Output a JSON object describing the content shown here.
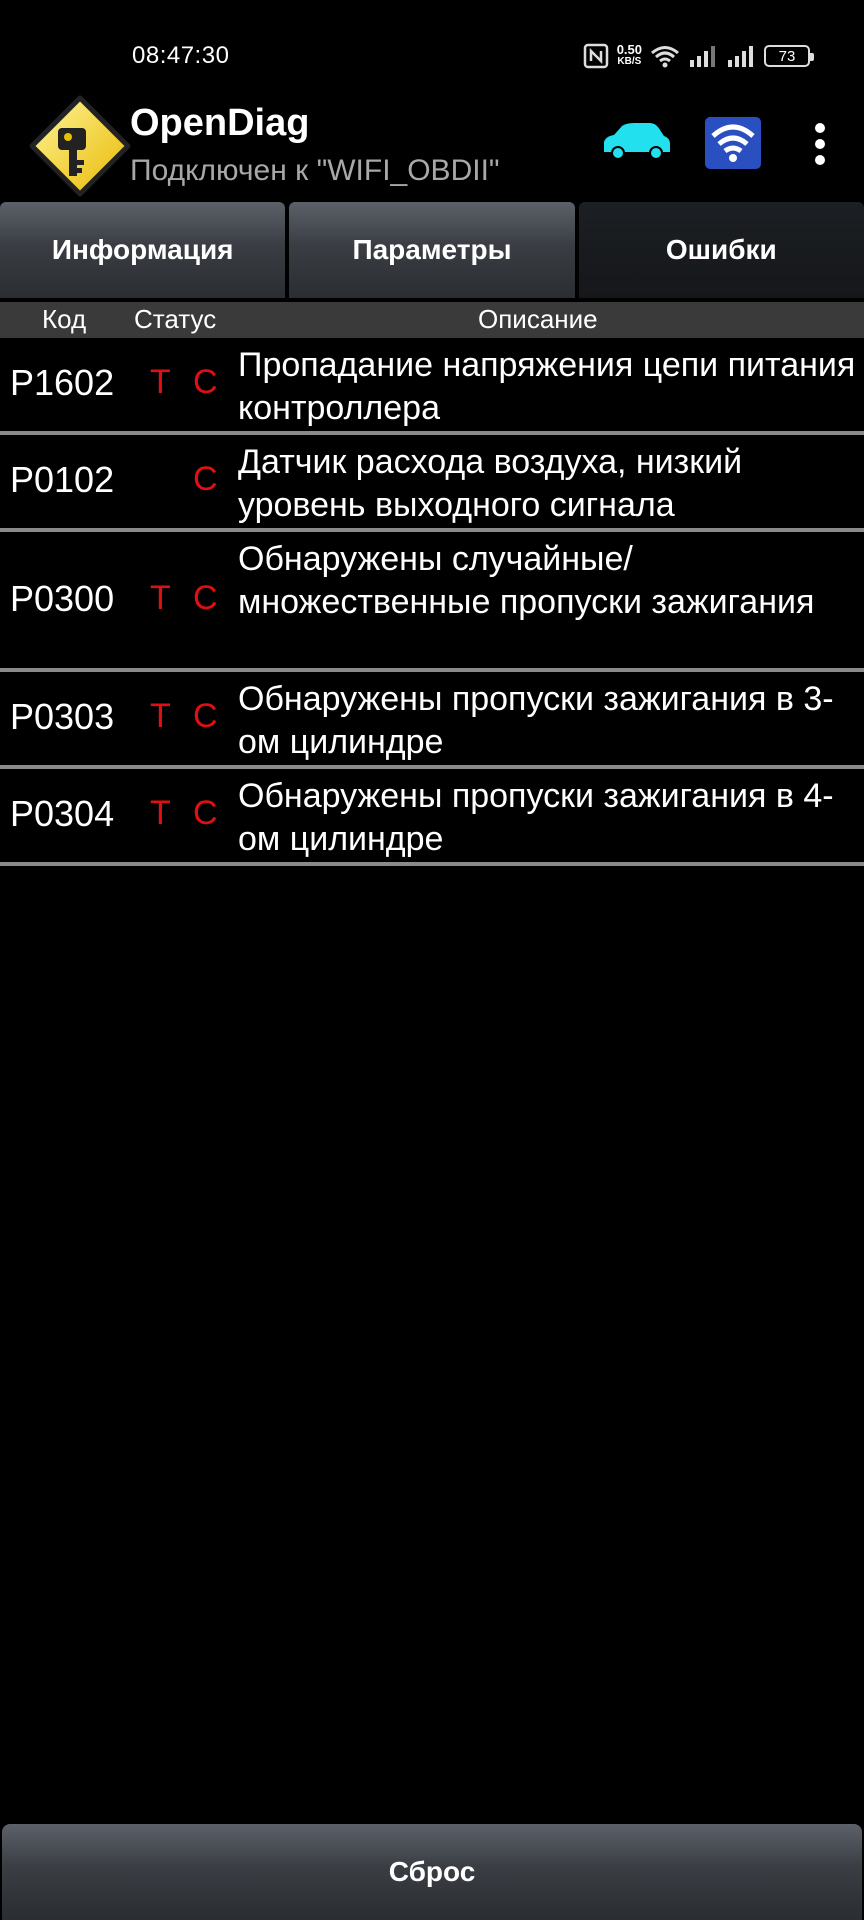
{
  "status_bar": {
    "time": "08:47:30",
    "speed_value": "0.50",
    "speed_unit": "KB/S",
    "battery": "73"
  },
  "app": {
    "title": "OpenDiag",
    "subtitle": "Подключен к \"WIFI_OBDII\"",
    "icons": [
      "key-logo-icon",
      "car-icon",
      "wifi-obd-icon",
      "more-vert-icon"
    ],
    "colors": {
      "car": "#22e0ee",
      "adapter": "#2a4fc0"
    }
  },
  "tabs": [
    {
      "label": "Информация",
      "active": false
    },
    {
      "label": "Параметры",
      "active": false
    },
    {
      "label": "Ошибки",
      "active": true
    }
  ],
  "table": {
    "headers": {
      "code": "Код",
      "status": "Статус",
      "description": "Описание"
    },
    "rows": [
      {
        "code": "P1602",
        "t": "T",
        "c": "C",
        "description": "Пропадание напряжения цепи питания контроллера"
      },
      {
        "code": "P0102",
        "t": "",
        "c": "C",
        "description": "Датчик расхода воздуха, низкий уровень выходного сигнала"
      },
      {
        "code": "P0300",
        "t": "T",
        "c": "C",
        "description": "Обнаружены случайные/ множественные пропуски зажигания"
      },
      {
        "code": "P0303",
        "t": "T",
        "c": "C",
        "description": "Обнаружены пропуски зажигания в 3-ом цилиндре"
      },
      {
        "code": "P0304",
        "t": "T",
        "c": "C",
        "description": "Обнаружены пропуски зажигания в 4-ом цилиндре"
      }
    ],
    "status_color": "#e01010"
  },
  "reset_label": "Сброс"
}
